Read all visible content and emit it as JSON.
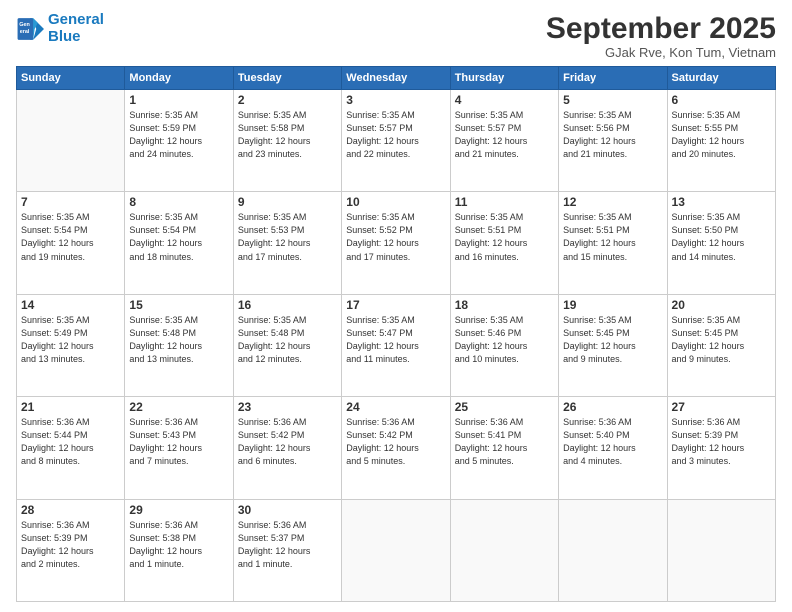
{
  "logo": {
    "line1": "General",
    "line2": "Blue"
  },
  "title": "September 2025",
  "subtitle": "GJak Rve, Kon Tum, Vietnam",
  "days_header": [
    "Sunday",
    "Monday",
    "Tuesday",
    "Wednesday",
    "Thursday",
    "Friday",
    "Saturday"
  ],
  "weeks": [
    [
      {
        "day": "",
        "info": ""
      },
      {
        "day": "1",
        "info": "Sunrise: 5:35 AM\nSunset: 5:59 PM\nDaylight: 12 hours\nand 24 minutes."
      },
      {
        "day": "2",
        "info": "Sunrise: 5:35 AM\nSunset: 5:58 PM\nDaylight: 12 hours\nand 23 minutes."
      },
      {
        "day": "3",
        "info": "Sunrise: 5:35 AM\nSunset: 5:57 PM\nDaylight: 12 hours\nand 22 minutes."
      },
      {
        "day": "4",
        "info": "Sunrise: 5:35 AM\nSunset: 5:57 PM\nDaylight: 12 hours\nand 21 minutes."
      },
      {
        "day": "5",
        "info": "Sunrise: 5:35 AM\nSunset: 5:56 PM\nDaylight: 12 hours\nand 21 minutes."
      },
      {
        "day": "6",
        "info": "Sunrise: 5:35 AM\nSunset: 5:55 PM\nDaylight: 12 hours\nand 20 minutes."
      }
    ],
    [
      {
        "day": "7",
        "info": "Sunrise: 5:35 AM\nSunset: 5:54 PM\nDaylight: 12 hours\nand 19 minutes."
      },
      {
        "day": "8",
        "info": "Sunrise: 5:35 AM\nSunset: 5:54 PM\nDaylight: 12 hours\nand 18 minutes."
      },
      {
        "day": "9",
        "info": "Sunrise: 5:35 AM\nSunset: 5:53 PM\nDaylight: 12 hours\nand 17 minutes."
      },
      {
        "day": "10",
        "info": "Sunrise: 5:35 AM\nSunset: 5:52 PM\nDaylight: 12 hours\nand 17 minutes."
      },
      {
        "day": "11",
        "info": "Sunrise: 5:35 AM\nSunset: 5:51 PM\nDaylight: 12 hours\nand 16 minutes."
      },
      {
        "day": "12",
        "info": "Sunrise: 5:35 AM\nSunset: 5:51 PM\nDaylight: 12 hours\nand 15 minutes."
      },
      {
        "day": "13",
        "info": "Sunrise: 5:35 AM\nSunset: 5:50 PM\nDaylight: 12 hours\nand 14 minutes."
      }
    ],
    [
      {
        "day": "14",
        "info": "Sunrise: 5:35 AM\nSunset: 5:49 PM\nDaylight: 12 hours\nand 13 minutes."
      },
      {
        "day": "15",
        "info": "Sunrise: 5:35 AM\nSunset: 5:48 PM\nDaylight: 12 hours\nand 13 minutes."
      },
      {
        "day": "16",
        "info": "Sunrise: 5:35 AM\nSunset: 5:48 PM\nDaylight: 12 hours\nand 12 minutes."
      },
      {
        "day": "17",
        "info": "Sunrise: 5:35 AM\nSunset: 5:47 PM\nDaylight: 12 hours\nand 11 minutes."
      },
      {
        "day": "18",
        "info": "Sunrise: 5:35 AM\nSunset: 5:46 PM\nDaylight: 12 hours\nand 10 minutes."
      },
      {
        "day": "19",
        "info": "Sunrise: 5:35 AM\nSunset: 5:45 PM\nDaylight: 12 hours\nand 9 minutes."
      },
      {
        "day": "20",
        "info": "Sunrise: 5:35 AM\nSunset: 5:45 PM\nDaylight: 12 hours\nand 9 minutes."
      }
    ],
    [
      {
        "day": "21",
        "info": "Sunrise: 5:36 AM\nSunset: 5:44 PM\nDaylight: 12 hours\nand 8 minutes."
      },
      {
        "day": "22",
        "info": "Sunrise: 5:36 AM\nSunset: 5:43 PM\nDaylight: 12 hours\nand 7 minutes."
      },
      {
        "day": "23",
        "info": "Sunrise: 5:36 AM\nSunset: 5:42 PM\nDaylight: 12 hours\nand 6 minutes."
      },
      {
        "day": "24",
        "info": "Sunrise: 5:36 AM\nSunset: 5:42 PM\nDaylight: 12 hours\nand 5 minutes."
      },
      {
        "day": "25",
        "info": "Sunrise: 5:36 AM\nSunset: 5:41 PM\nDaylight: 12 hours\nand 5 minutes."
      },
      {
        "day": "26",
        "info": "Sunrise: 5:36 AM\nSunset: 5:40 PM\nDaylight: 12 hours\nand 4 minutes."
      },
      {
        "day": "27",
        "info": "Sunrise: 5:36 AM\nSunset: 5:39 PM\nDaylight: 12 hours\nand 3 minutes."
      }
    ],
    [
      {
        "day": "28",
        "info": "Sunrise: 5:36 AM\nSunset: 5:39 PM\nDaylight: 12 hours\nand 2 minutes."
      },
      {
        "day": "29",
        "info": "Sunrise: 5:36 AM\nSunset: 5:38 PM\nDaylight: 12 hours\nand 1 minute."
      },
      {
        "day": "30",
        "info": "Sunrise: 5:36 AM\nSunset: 5:37 PM\nDaylight: 12 hours\nand 1 minute."
      },
      {
        "day": "",
        "info": ""
      },
      {
        "day": "",
        "info": ""
      },
      {
        "day": "",
        "info": ""
      },
      {
        "day": "",
        "info": ""
      }
    ]
  ]
}
